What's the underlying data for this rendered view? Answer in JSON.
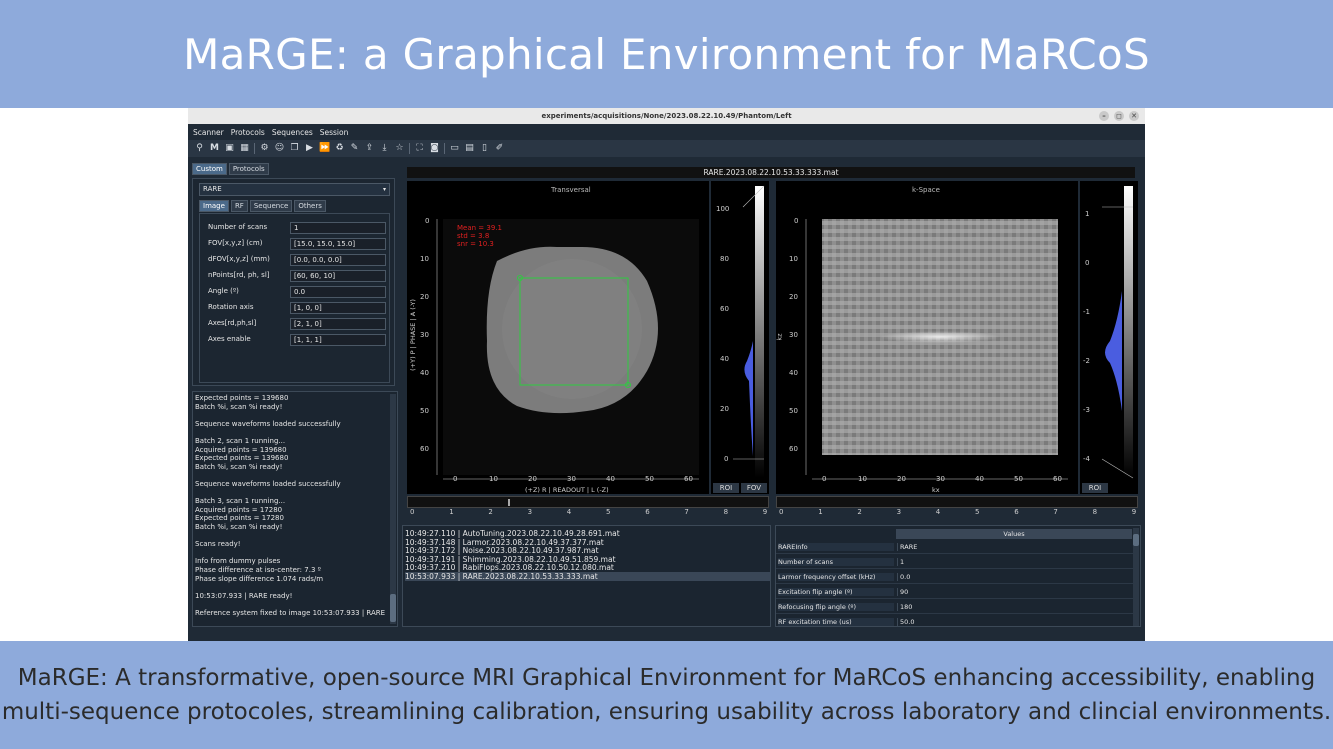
{
  "slide": {
    "title": "MaRGE: a Graphical Environment for MaRCoS",
    "caption_line1": "MaRGE: A transformative, open-source MRI Graphical Environment for MaRCoS enhancing accessibility, enabling",
    "caption_line2": "multi-sequence protocoles, streamlining calibration, ensuring usability across laboratory and clincial environments."
  },
  "window": {
    "title": "experiments/acquisitions/None/2023.08.22.10.49/Phantom/Left",
    "buttons": [
      "–",
      "◻",
      "✕"
    ]
  },
  "menu": [
    "Scanner",
    "Protocols",
    "Sequences",
    "Session"
  ],
  "toolbar_icons": [
    "wand-icon",
    "marcos-icon",
    "settings-icon",
    "grid-icon",
    "gear-icon",
    "person-icon",
    "copy-icon",
    "play-icon",
    "fast-forward-icon",
    "trash-icon",
    "edit-icon",
    "upload-icon",
    "download-icon",
    "star-icon",
    "fullscreen-icon",
    "camera-icon",
    "window-icon",
    "folder-icon",
    "file-icon",
    "file-edit-icon"
  ],
  "left_tabs": [
    "Custom",
    "Protocols"
  ],
  "sequence": "RARE",
  "sub_tabs": [
    "Image",
    "RF",
    "Sequence",
    "Others"
  ],
  "params": [
    {
      "label": "Number of scans",
      "value": "1"
    },
    {
      "label": "FOV[x,y,z] (cm)",
      "value": "[15.0, 15.0, 15.0]"
    },
    {
      "label": "dFOV[x,y,z] (mm)",
      "value": "[0.0, 0.0, 0.0]"
    },
    {
      "label": "nPoints[rd, ph, sl]",
      "value": "[60, 60, 10]"
    },
    {
      "label": "Angle (º)",
      "value": "0.0"
    },
    {
      "label": "Rotation axis",
      "value": "[1, 0, 0]"
    },
    {
      "label": "Axes[rd,ph,sl]",
      "value": "[2, 1, 0]"
    },
    {
      "label": "Axes enable",
      "value": "[1, 1, 1]"
    }
  ],
  "log": [
    "Expected points = 139680",
    "Batch %i, scan %i ready!",
    "",
    "Sequence waveforms loaded successfully",
    "",
    "Batch 2, scan 1 running...",
    "Acquired points = 139680",
    "Expected points = 139680",
    "Batch %i, scan %i ready!",
    "",
    "Sequence waveforms loaded successfully",
    "",
    "Batch 3, scan 1 running...",
    "Acquired points = 17280",
    "Expected points = 17280",
    "Batch %i, scan %i ready!",
    "",
    "Scans ready!",
    "",
    "Info from dummy pulses",
    "Phase difference at iso-center: 7.3 º",
    "Phase slope difference 1.074 rads/m",
    "",
    "10:53:07.933 | RARE ready!",
    "",
    "Reference system fixed to image 10:53:07.933 | RARE"
  ],
  "image_window": {
    "filename": "RARE.2023.08.22.10.53.33.333.mat",
    "left_panel": {
      "title": "Transversal",
      "ylabel": "(+Y) P | PHASE | A (-Y)",
      "xlabel": "(+Z) R | READOUT | L (-Z)",
      "yticks": [
        "0",
        "10",
        "20",
        "30",
        "40",
        "50",
        "60"
      ],
      "xticks": [
        "0",
        "10",
        "20",
        "30",
        "40",
        "50",
        "60"
      ],
      "stats": [
        "Mean = 39.1",
        "std = 3.8",
        "snr = 10.3"
      ],
      "hist_ticks": [
        "100",
        "80",
        "60",
        "40",
        "20",
        "0"
      ],
      "buttons": [
        "ROI",
        "FOV"
      ]
    },
    "right_panel": {
      "title": "k-Space",
      "ylabel": "kz",
      "xlabel": "kx",
      "yticks": [
        "0",
        "10",
        "20",
        "30",
        "40",
        "50",
        "60"
      ],
      "xticks": [
        "0",
        "10",
        "20",
        "30",
        "40",
        "50",
        "60"
      ],
      "hist_ticks": [
        "1",
        "0",
        "-1",
        "-2",
        "-3",
        "-4"
      ],
      "buttons": [
        "ROI"
      ]
    },
    "slider_ticks": [
      "0",
      "1",
      "2",
      "3",
      "4",
      "5",
      "6",
      "7",
      "8",
      "9"
    ]
  },
  "history": [
    "10:49:27.110 | AutoTuning.2023.08.22.10.49.28.691.mat",
    "10:49:37.148 | Larmor.2023.08.22.10.49.37.377.mat",
    "10:49:37.172 | Noise.2023.08.22.10.49.37.987.mat",
    "10:49:37.191 | Shimming.2023.08.22.10.49.51.859.mat",
    "10:49:37.210 | RabiFlops.2023.08.22.10.50.12.080.mat",
    "10:53:07.933 | RARE.2023.08.22.10.53.33.333.mat"
  ],
  "info_table": {
    "header": "Values",
    "rows": [
      {
        "key": "RAREInfo",
        "value": "RARE"
      },
      {
        "key": "Number of scans",
        "value": "1"
      },
      {
        "key": "Larmor frequency offset (kHz)",
        "value": "0.0"
      },
      {
        "key": "Excitation flip angle (º)",
        "value": "90"
      },
      {
        "key": "Refocusing flip angle (º)",
        "value": "180"
      },
      {
        "key": "RF excitation time (us)",
        "value": "50.0"
      }
    ]
  },
  "colors": {
    "header_band": "#8eaadb",
    "app_bg": "#1f2a36",
    "roi": "#2ecc40",
    "stats": "#e02020"
  }
}
